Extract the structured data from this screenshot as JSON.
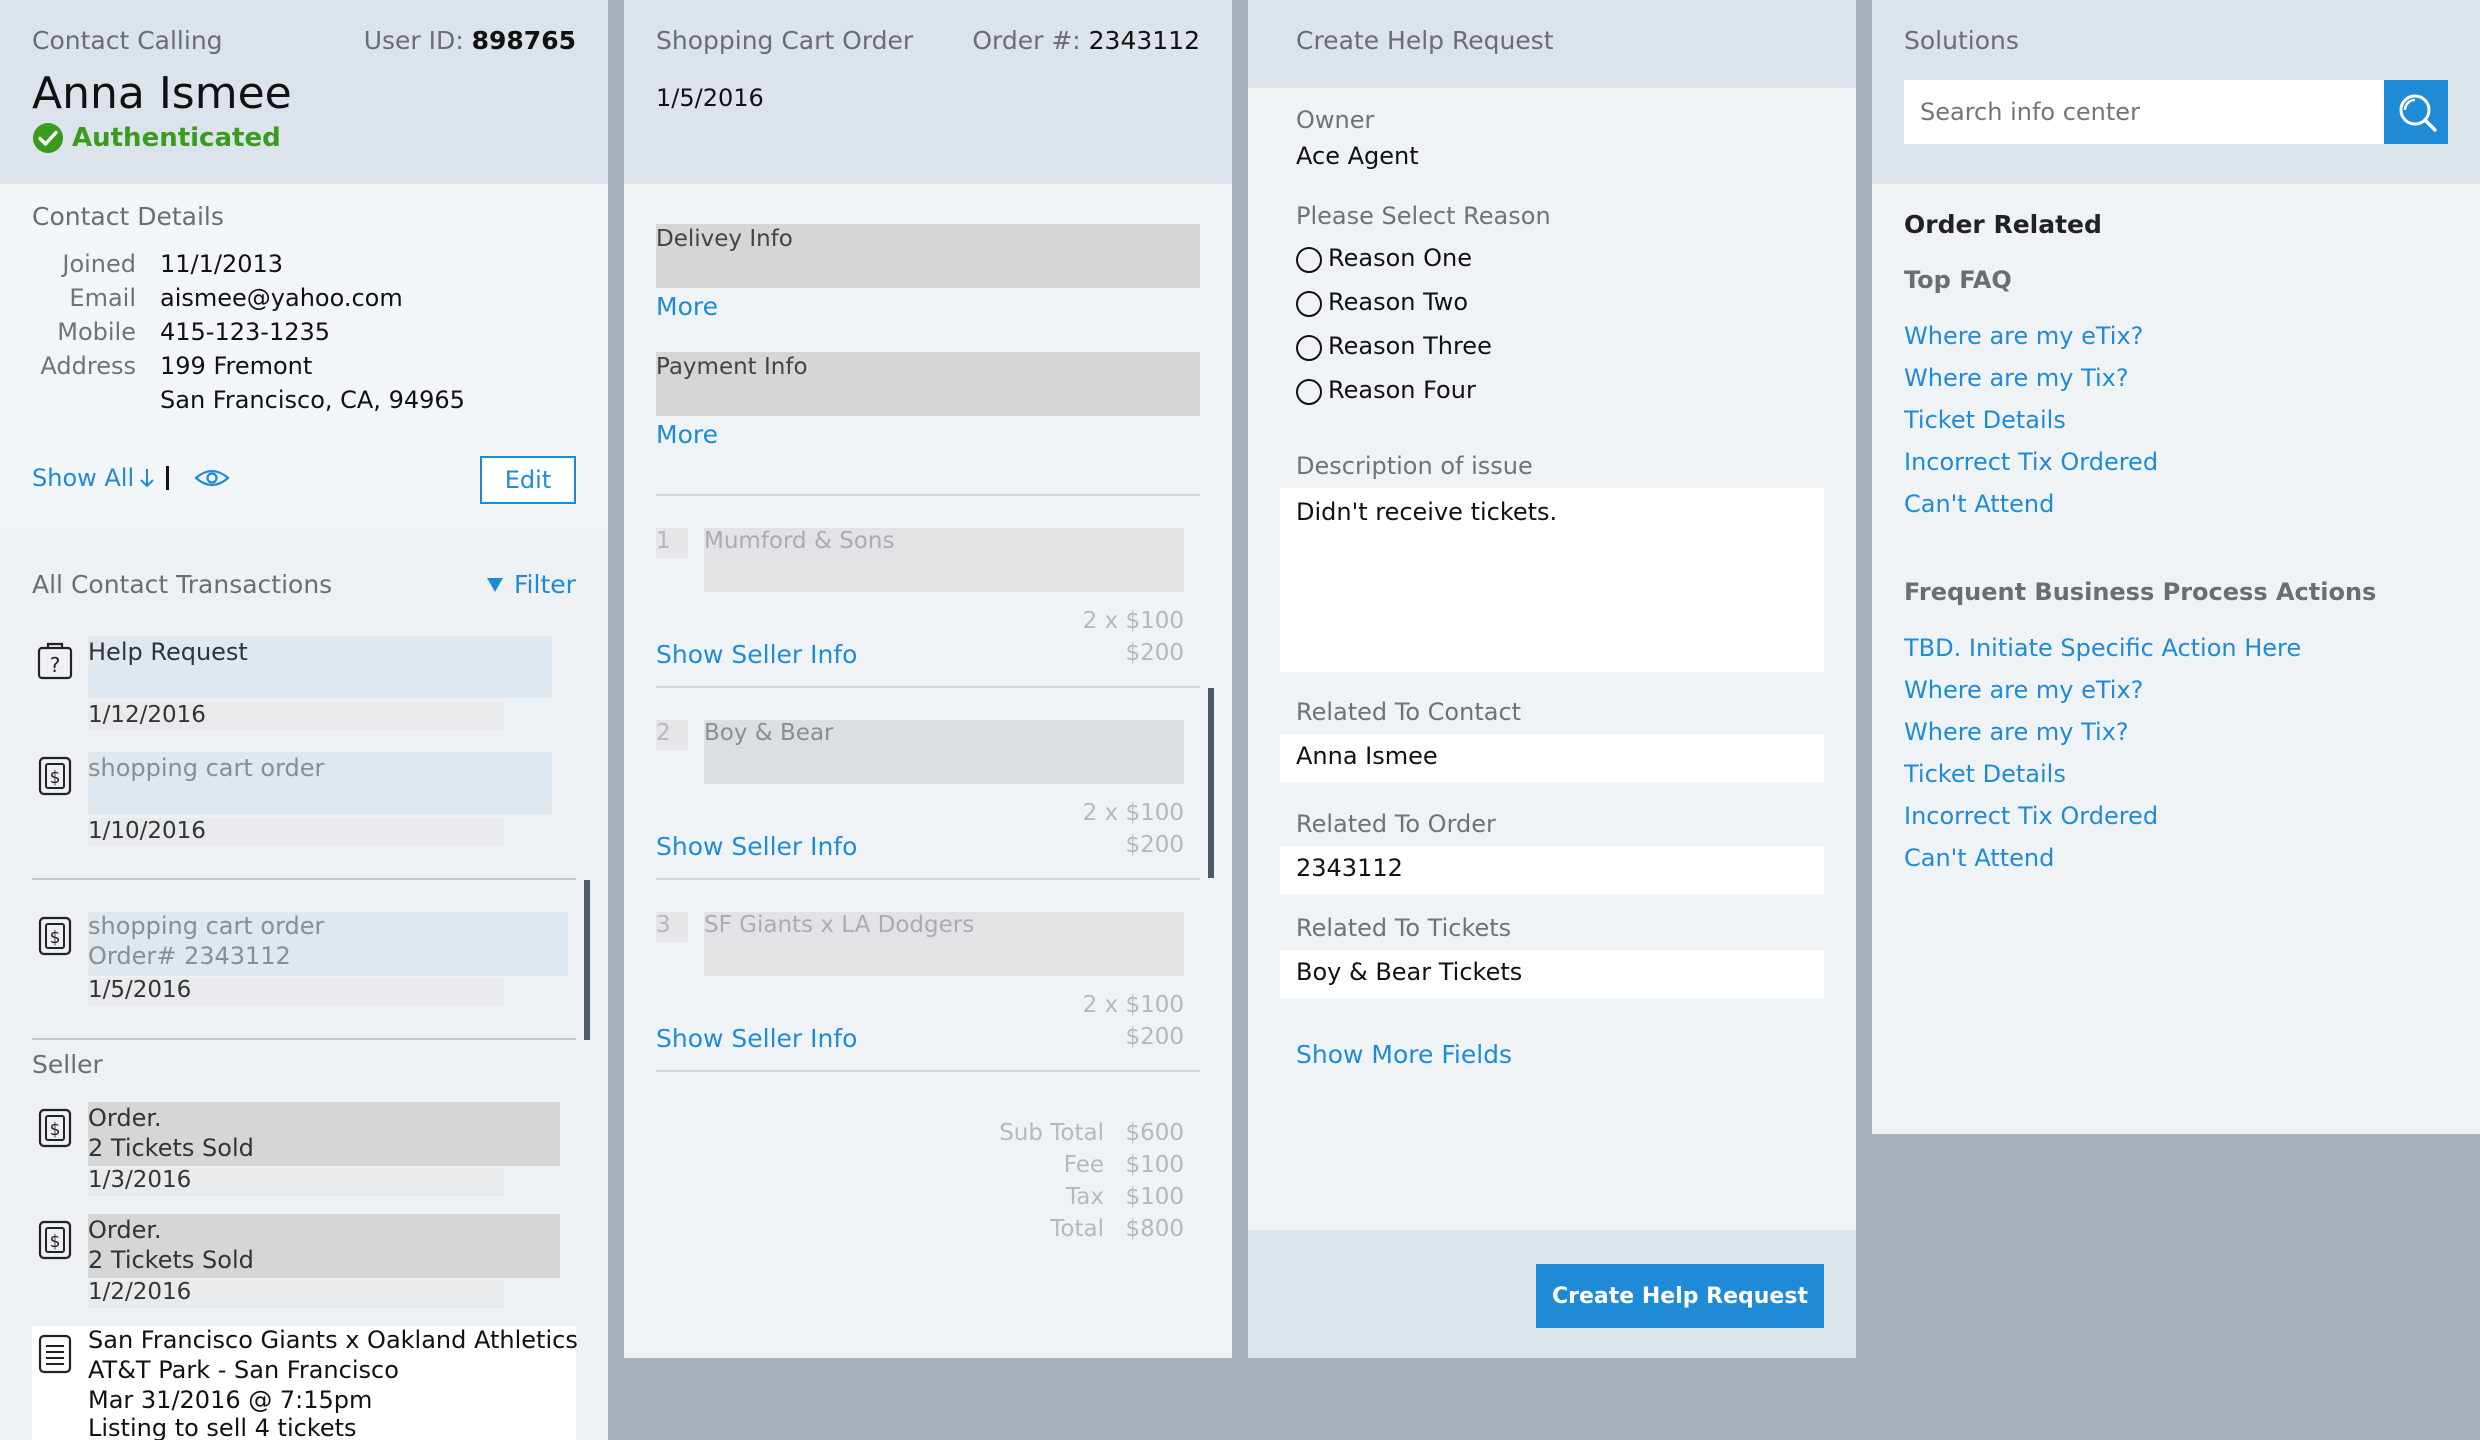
{
  "contact": {
    "title": "Contact Calling",
    "user_id_label": "User ID:",
    "user_id": "898765",
    "name": "Anna Ismee",
    "status": "Authenticated",
    "details_title": "Contact Details",
    "details": [
      {
        "label": "Joined",
        "value": "11/1/2013"
      },
      {
        "label": "Email",
        "value": "aismee@yahoo.com"
      },
      {
        "label": "Mobile",
        "value": "415-123-1235"
      },
      {
        "label": "Address",
        "value": "199 Fremont"
      }
    ],
    "address_line2": "San Francisco, CA, 94965",
    "show_all": "Show All",
    "edit": "Edit",
    "transactions_title": "All Contact Transactions",
    "filter": "Filter",
    "transactions": [
      {
        "title": "Help Request",
        "date": "1/12/2016"
      },
      {
        "title": "shopping cart order",
        "date": "1/10/2016"
      },
      {
        "title": "shopping cart order",
        "subtitle": "Order# 2343112",
        "date": "1/5/2016"
      }
    ],
    "seller_title": "Seller",
    "seller_items": [
      {
        "line1": "Order.",
        "line2": "2 Tickets Sold",
        "date": "1/3/2016"
      },
      {
        "line1": "Order.",
        "line2": "2 Tickets Sold",
        "date": "1/2/2016"
      }
    ],
    "listing": {
      "line1": "San Francisco Giants x Oakland Athletics",
      "line2": "AT&T Park - San Francisco",
      "line3": "Mar 31/2016 @ 7:15pm",
      "line4": "Listing to sell 4 tickets"
    }
  },
  "cart": {
    "title": "Shopping Cart Order",
    "order_label": "Order #:",
    "order_number": "2343112",
    "date": "1/5/2016",
    "delivery": "Delivey Info",
    "payment": "Payment Info",
    "more": "More",
    "items": [
      {
        "index": "1",
        "name": "Mumford & Sons",
        "qty": "2 x $100",
        "total": "$200"
      },
      {
        "index": "2",
        "name": "Boy & Bear",
        "qty": "2 x $100",
        "total": "$200"
      },
      {
        "index": "3",
        "name": "SF Giants x LA Dodgers",
        "qty": "2 x $100",
        "total": "$200"
      }
    ],
    "show_seller_info": "Show Seller Info",
    "summary": [
      {
        "label": "Sub Total",
        "value": "$600"
      },
      {
        "label": "Fee",
        "value": "$100"
      },
      {
        "label": "Tax",
        "value": "$100"
      },
      {
        "label": "Total",
        "value": "$800"
      }
    ]
  },
  "help": {
    "title": "Create Help Request",
    "owner_label": "Owner",
    "owner": "Ace Agent",
    "reason_label": "Please Select Reason",
    "reasons": [
      "Reason One",
      "Reason Two",
      "Reason Three",
      "Reason Four"
    ],
    "description_label": "Description of issue",
    "description": "Didn't receive tickets.",
    "contact_label": "Related To Contact",
    "contact": "Anna Ismee",
    "order_label": "Related To Order",
    "order": "2343112",
    "tickets_label": "Related To Tickets",
    "tickets": "Boy & Bear Tickets",
    "show_more": "Show More Fields",
    "submit": "Create Help Request"
  },
  "solutions": {
    "title": "Solutions",
    "search_placeholder": "Search info center",
    "order_related": "Order Related",
    "top_faq": "Top FAQ",
    "faq": [
      "Where are my eTix?",
      "Where are my Tix?",
      "Ticket Details",
      "Incorrect Tix Ordered",
      "Can't Attend"
    ],
    "frequent_title": "Frequent Business Process Actions",
    "actions": [
      "TBD. Initiate Specific Action Here",
      "Where are my eTix?",
      "Where are my Tix?",
      "Ticket Details",
      "Incorrect Tix Ordered",
      "Can't Attend"
    ]
  },
  "colors": {
    "accent": "#1f8bd6",
    "success": "#3a9b1f",
    "header_bg": "#dde3ea",
    "panel_bg": "#f2f5f8",
    "backdrop": "#a9b1bd"
  }
}
